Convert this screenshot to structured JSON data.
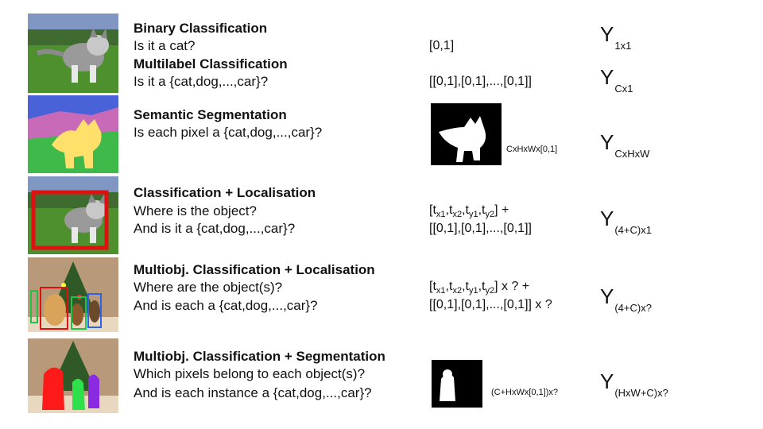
{
  "rows": [
    {
      "title": "Binary Classification",
      "q1": "Is it a cat?",
      "out1": "[0,1]",
      "y_base": "Y",
      "y_sub": "1x1"
    },
    {
      "title": "Multilabel Classification",
      "q1": "Is it a {cat,dog,...,car}?",
      "out1": "[[0,1],[0,1],...,[0,1]]",
      "y_base": "Y",
      "y_sub": "Cx1"
    },
    {
      "title": "Semantic Segmentation",
      "q1": "Is each pixel a {cat,dog,...,car}?",
      "mask_label": "CxHxWx[0,1]",
      "y_base": "Y",
      "y_sub": "CxHxW"
    },
    {
      "title": "Classification + Localisation",
      "q1": "Where is the object?",
      "q2": "And is it a {cat,dog,...,car}?",
      "out_t": "t",
      "out_sub": [
        "x1",
        "x2",
        "y1",
        "y2"
      ],
      "out_tail": "] +",
      "out2": "[[0,1],[0,1],...,[0,1]]",
      "y_base": "Y",
      "y_sub": "(4+C)x1"
    },
    {
      "title": "Multiobj. Classification + Localisation",
      "q1": "Where are the object(s)?",
      "q2": "And is each a {cat,dog,...,car}?",
      "out_t": "t",
      "out_sub": [
        "x1",
        "x2",
        "y1",
        "y2"
      ],
      "out_tail": "] x ? +",
      "out2": "[[0,1],[0,1],...,[0,1]] x ?",
      "y_base": "Y",
      "y_sub": "(4+C)x?"
    },
    {
      "title": "Multiobj. Classification + Segmentation",
      "q1": "Which pixels belong to each object(s)?",
      "q2": "And is each instance a {cat,dog,...,car}?",
      "mask_label": "(C+HxWx[0,1])x?",
      "y_base": "Y",
      "y_sub": "(HxW+C)x?"
    }
  ],
  "colors": {
    "grass": "#4e8f2e",
    "sky": "#6a7fb0",
    "seg_sky": "#4a62d8",
    "seg_tree": "#c96ab8",
    "seg_grass": "#3fb94a",
    "seg_cat": "#ffe06a",
    "bbox_red": "#e01010",
    "bbox_green": "#21c14d",
    "bbox_blue": "#2c63e8",
    "inst_red": "#ff1a1a",
    "inst_green": "#2ee04a",
    "inst_purple": "#8a2be2"
  }
}
